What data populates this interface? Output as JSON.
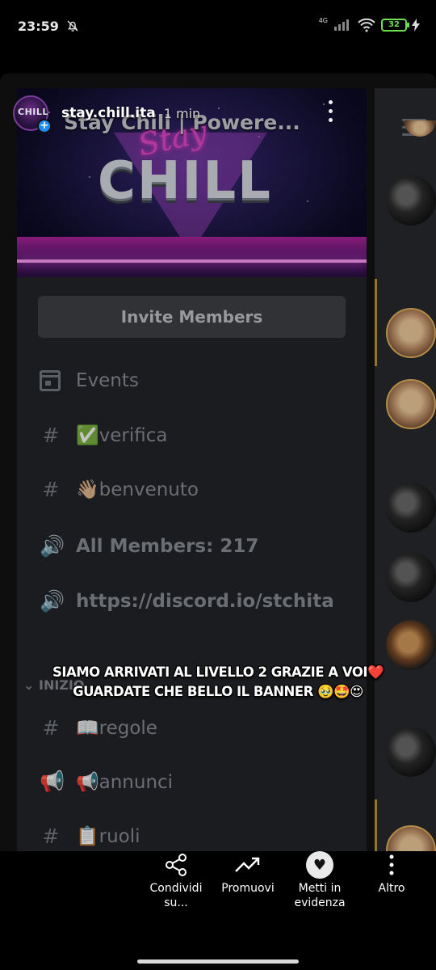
{
  "status_bar": {
    "time": "23:59",
    "network": "4G",
    "battery": "32"
  },
  "story": {
    "progress": 1.0,
    "username": "stay.chill.ita",
    "time_ago": "1 min",
    "background_server_title": "Stay Chill | Powere...",
    "caption_line1": "SIAMO ARRIVATI AL LIVELLO 2 GRAZIE A VOI❤️",
    "caption_line2": "GUARDATE CHE BELLO IL BANNER 🥹🤩😍"
  },
  "banner": {
    "script_text": "Stay",
    "main_text": "CHILL"
  },
  "logo": {
    "text": "CHILL"
  },
  "server_sidebar": {
    "invite_label": "Invite Members",
    "category_label": "INIZIO",
    "channels": [
      {
        "icon": "calendar-icon",
        "label": "Events"
      },
      {
        "icon": "hash-icon",
        "label": "✅verifica"
      },
      {
        "icon": "hash-icon",
        "label": "👋🏼benvenuto"
      },
      {
        "icon": "voice-locked-icon",
        "label": "All Members: 217"
      },
      {
        "icon": "voice-locked-icon",
        "label": "https://discord.io/stchita"
      },
      {
        "icon": "hash-icon",
        "label": "📖regole"
      },
      {
        "icon": "megaphone-icon",
        "label": "📢annunci"
      },
      {
        "icon": "hash-locked-icon",
        "label": "📋ruoli"
      }
    ]
  },
  "actions": [
    {
      "icon": "share-icon",
      "label": "Condividi su..."
    },
    {
      "icon": "trending-up-icon",
      "label": "Promuovi"
    },
    {
      "icon": "heart-icon",
      "label": "Metti in evidenza"
    },
    {
      "icon": "more-vertical-icon",
      "label": "Altro"
    }
  ],
  "colors": {
    "accent_blue": "#1f8cf0",
    "battery_green": "#6ddf50",
    "drawer_bg": "#232428",
    "invite_bg": "#3e4045",
    "gold": "#c5962f"
  }
}
